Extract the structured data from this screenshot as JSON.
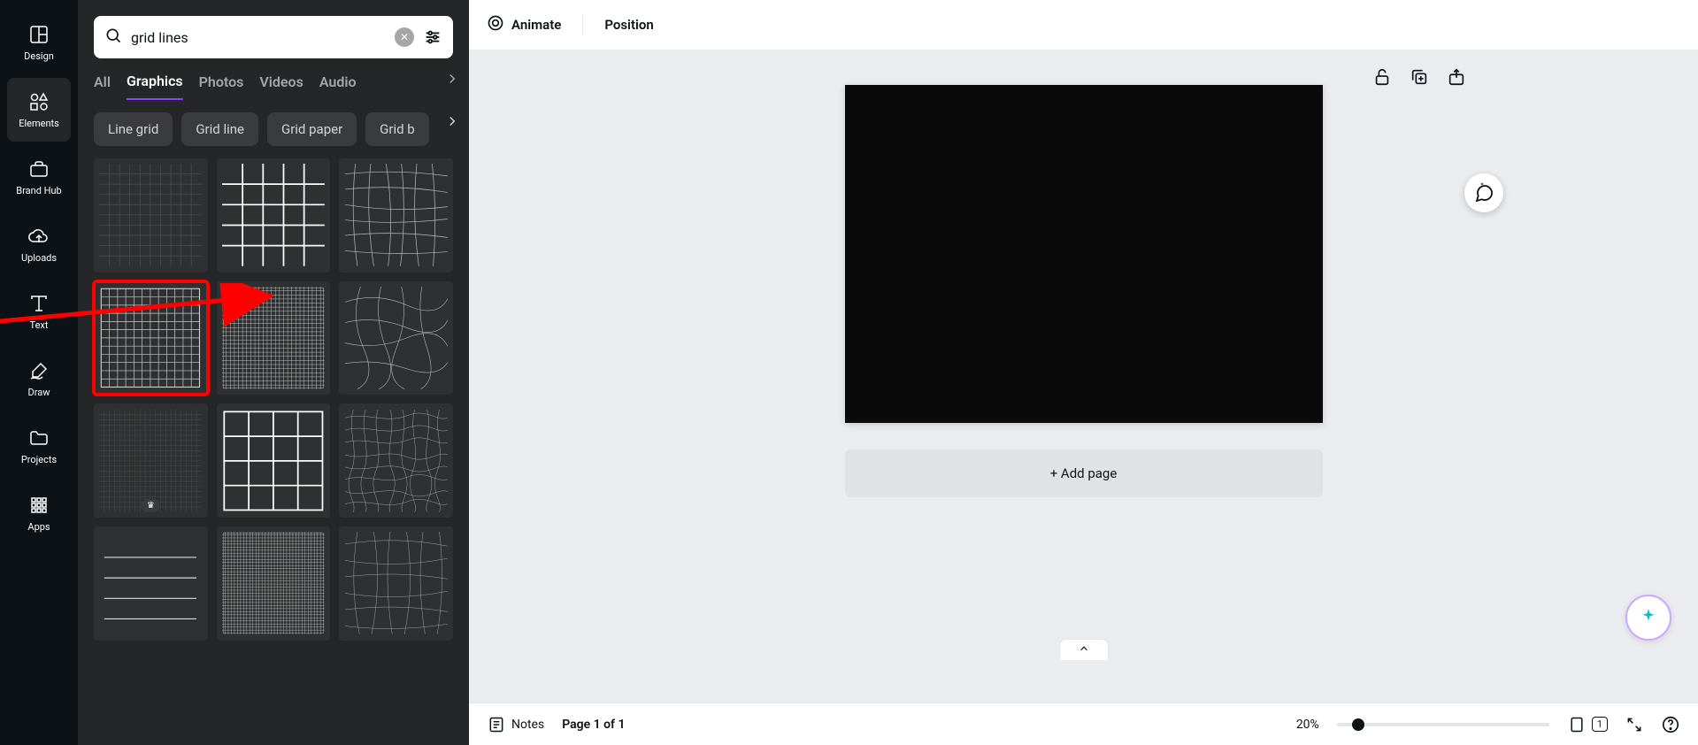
{
  "rail": {
    "items": [
      {
        "label": "Design"
      },
      {
        "label": "Elements"
      },
      {
        "label": "Brand Hub"
      },
      {
        "label": "Uploads"
      },
      {
        "label": "Text"
      },
      {
        "label": "Draw"
      },
      {
        "label": "Projects"
      },
      {
        "label": "Apps"
      }
    ]
  },
  "search": {
    "value": "grid lines"
  },
  "tabs": [
    "All",
    "Graphics",
    "Photos",
    "Videos",
    "Audio"
  ],
  "active_tab": "Graphics",
  "chips": [
    "Line grid",
    "Grid line",
    "Grid paper",
    "Grid b"
  ],
  "topbar": {
    "animate": "Animate",
    "position": "Position"
  },
  "add_page_label": "+ Add page",
  "bottom": {
    "notes": "Notes",
    "page_label": "Page 1 of 1",
    "zoom": "20%",
    "page_count": "1"
  }
}
